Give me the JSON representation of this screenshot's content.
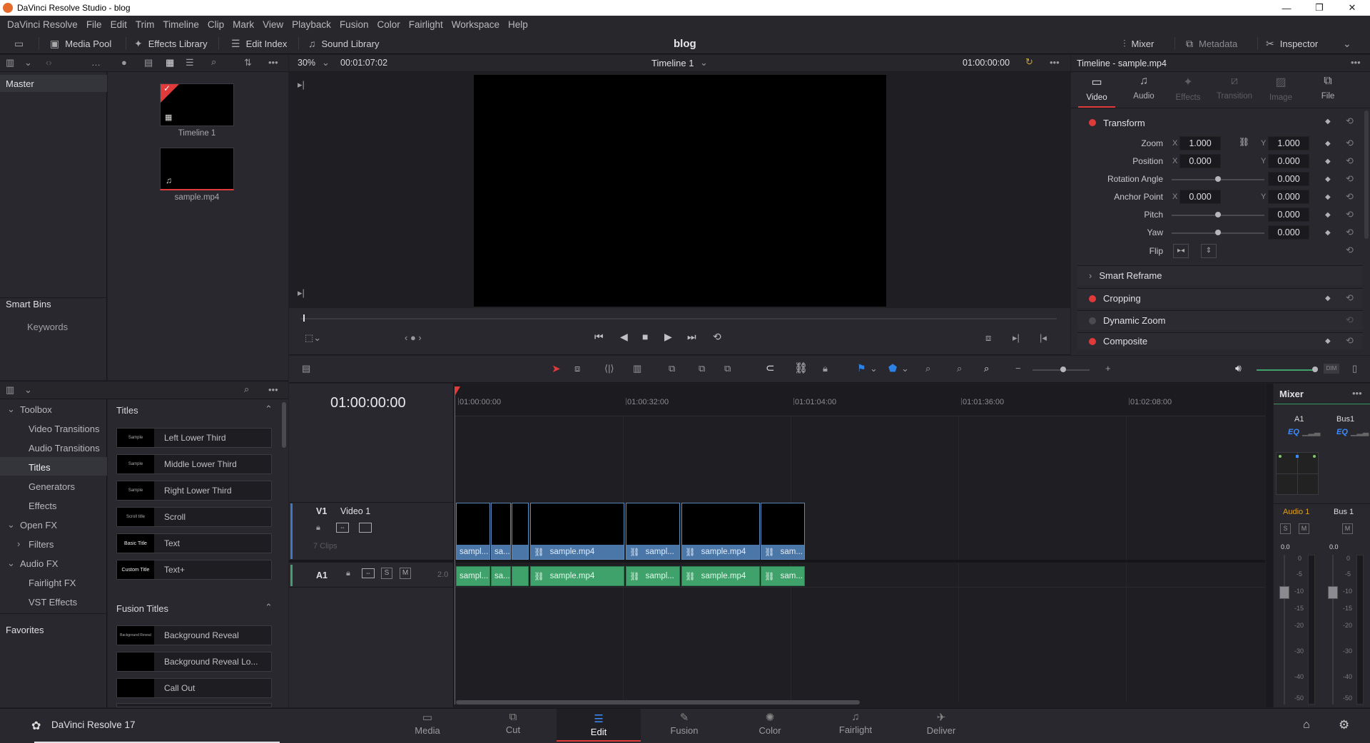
{
  "window": {
    "title": "DaVinci Resolve Studio - blog",
    "minimize": "—",
    "maximize": "❐",
    "close": "✕"
  },
  "menu": [
    "DaVinci Resolve",
    "File",
    "Edit",
    "Trim",
    "Timeline",
    "Clip",
    "Mark",
    "View",
    "Playback",
    "Fusion",
    "Color",
    "Fairlight",
    "Workspace",
    "Help"
  ],
  "toolbar": {
    "media_pool": "Media Pool",
    "effects_library": "Effects Library",
    "edit_index": "Edit Index",
    "sound_library": "Sound Library",
    "project_name": "blog",
    "mixer": "Mixer",
    "metadata": "Metadata",
    "inspector": "Inspector"
  },
  "media_pool": {
    "bins_title": "Master",
    "smart_bins": "Smart Bins",
    "keywords": "Keywords",
    "clips": [
      {
        "name": "Timeline 1",
        "kind": "timeline"
      },
      {
        "name": "sample.mp4",
        "kind": "audio-video"
      }
    ]
  },
  "viewer": {
    "zoom": "30%",
    "duration": "00:01:07:02",
    "timeline_name": "Timeline 1",
    "timecode": "01:00:00:00"
  },
  "effects": {
    "toolbox": "Toolbox",
    "tree": [
      {
        "label": "Video Transitions",
        "level": 1
      },
      {
        "label": "Audio Transitions",
        "level": 1
      },
      {
        "label": "Titles",
        "level": 1,
        "selected": true
      },
      {
        "label": "Generators",
        "level": 1
      },
      {
        "label": "Effects",
        "level": 1
      },
      {
        "label": "Open FX",
        "level": 0
      },
      {
        "label": "Filters",
        "level": 1
      },
      {
        "label": "Audio FX",
        "level": 0
      },
      {
        "label": "Fairlight FX",
        "level": 1
      },
      {
        "label": "VST Effects",
        "level": 1
      }
    ],
    "favorites": "Favorites",
    "titles_header": "Titles",
    "titles": [
      "Left Lower Third",
      "Middle Lower Third",
      "Right Lower Third",
      "Scroll",
      "Text",
      "Text+"
    ],
    "title_thumbs": [
      "Sample",
      "Sample",
      "Sample",
      "Scroll title",
      "Basic Title",
      "Custom Title"
    ],
    "fusion_titles_header": "Fusion Titles",
    "fusion_titles": [
      "Background Reveal",
      "Background Reveal Lo...",
      "Call Out"
    ],
    "fusion_thumbs": [
      "Background Reveal",
      "",
      ""
    ]
  },
  "inspector": {
    "title": "Timeline - sample.mp4",
    "tabs": [
      "Video",
      "Audio",
      "Effects",
      "Transition",
      "Image",
      "File"
    ],
    "transform": "Transform",
    "zoom_label": "Zoom",
    "zoom_x": "1.000",
    "zoom_y": "1.000",
    "position_label": "Position",
    "pos_x": "0.000",
    "pos_y": "0.000",
    "rotation_label": "Rotation Angle",
    "rotation": "0.000",
    "anchor_label": "Anchor Point",
    "anchor_x": "0.000",
    "anchor_y": "0.000",
    "pitch_label": "Pitch",
    "pitch": "0.000",
    "yaw_label": "Yaw",
    "yaw": "0.000",
    "flip_label": "Flip",
    "x": "X",
    "y": "Y",
    "smart_reframe": "Smart Reframe",
    "cropping": "Cropping",
    "dynamic_zoom": "Dynamic Zoom",
    "composite": "Composite"
  },
  "timeline": {
    "timecode": "01:00:00:00",
    "ruler": [
      "01:00:00:00",
      "01:00:32:00",
      "01:01:04:00",
      "01:01:36:00",
      "01:02:08:00"
    ],
    "v1": {
      "id": "V1",
      "name": "Video 1",
      "clip_count": "7 Clips"
    },
    "a1": {
      "id": "A1",
      "level": "2.0",
      "solo": "S",
      "mute": "M"
    },
    "video_clips": [
      "sampl...",
      "sa...",
      "",
      "sample.mp4",
      "sampl...",
      "sample.mp4",
      "sam..."
    ],
    "audio_clips": [
      "sampl...",
      "sa...",
      "",
      "sample.mp4",
      "sampl...",
      "sample.mp4",
      "sam..."
    ]
  },
  "mixer": {
    "title": "Mixer",
    "channels": [
      "A1",
      "Bus1"
    ],
    "eq": "EQ",
    "labels": [
      "Audio 1",
      "Bus 1"
    ],
    "solo": "S",
    "mute": "M",
    "levels": [
      "0.0",
      "0.0"
    ],
    "scale": [
      "0",
      "-5",
      "-10",
      "-15",
      "-20",
      "-30",
      "-40",
      "-50"
    ]
  },
  "pages": [
    "Media",
    "Cut",
    "Edit",
    "Fusion",
    "Color",
    "Fairlight",
    "Deliver"
  ],
  "active_page": "Edit",
  "app_version": "DaVinci Resolve 17",
  "colors": {
    "accent_red": "#e03a3a",
    "video_clip": "#4a76a8",
    "audio_clip": "#3fa26a",
    "playhead": "#e03a3a"
  }
}
